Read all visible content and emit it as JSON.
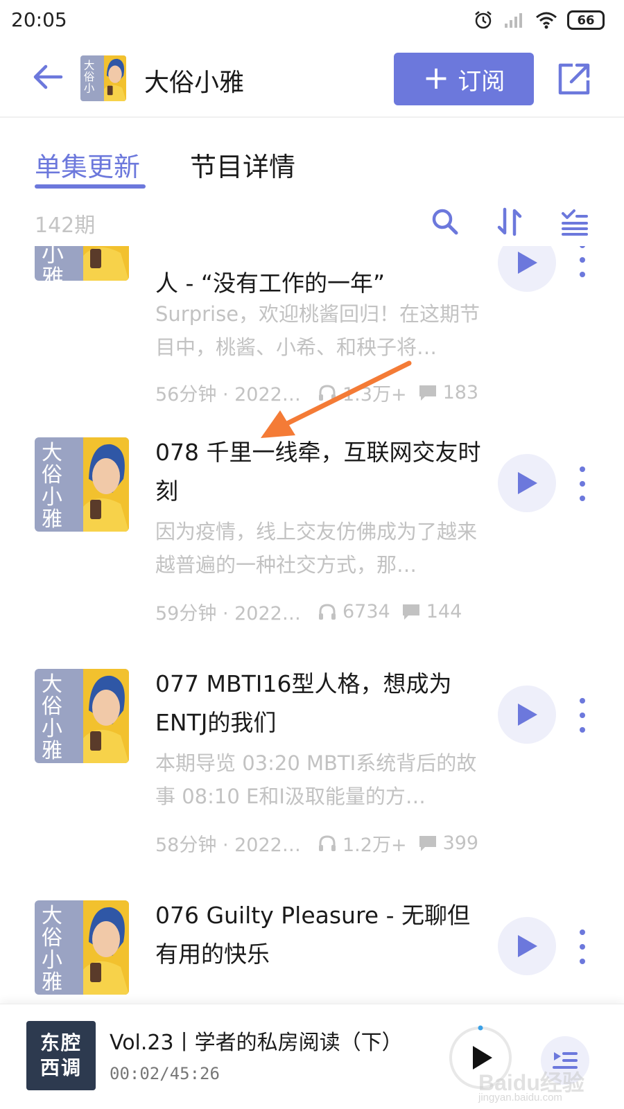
{
  "status_bar": {
    "time": "20:05",
    "battery": "66"
  },
  "header": {
    "title": "大俗小雅",
    "subscribe_label": "订阅",
    "cover_text": "大俗小雅"
  },
  "tabs": [
    {
      "label": "单集更新",
      "active": true
    },
    {
      "label": "节目详情",
      "active": false
    }
  ],
  "list_toolbar": {
    "count": "142期"
  },
  "episodes": [
    {
      "title_line": "人 - “没有工作的一年”",
      "desc": "Surprise，欢迎桃酱回归！在这期节目中，桃酱、小希、和秧子将…",
      "duration_date": "56分钟 · 2022…",
      "plays": "1.3万+",
      "comments": "183"
    },
    {
      "title": "078 千里一线牵，互联网交友时刻",
      "desc": "因为疫情，线上交友仿佛成为了越来越普遍的一种社交方式，那…",
      "duration_date": "59分钟 · 2022/…",
      "plays": "6734",
      "comments": "144"
    },
    {
      "title": "077 MBTI16型人格，想成为ENTJ的我们",
      "desc": "本期导览 03:20 MBTI系统背后的故事 08:10 E和I汲取能量的方…",
      "duration_date": "58分钟 · 2022…",
      "plays": "1.2万+",
      "comments": "399"
    },
    {
      "title": "076 Guilty Pleasure - 无聊但有用的快乐"
    }
  ],
  "mini_player": {
    "cover_line1": "东腔",
    "cover_line2": "西调",
    "title": "Vol.23丨学者的私房阅读（下）",
    "time": "00:02/45:26"
  },
  "watermark": {
    "main": "Baidu经验",
    "sub": "jingyan.baidu.com"
  },
  "colors": {
    "accent": "#6c78dc",
    "annotation": "#f47b36",
    "cover_bg": "#9aa3c3",
    "cover_yellow": "#f2c12e",
    "cover_blue": "#2f57a6"
  }
}
